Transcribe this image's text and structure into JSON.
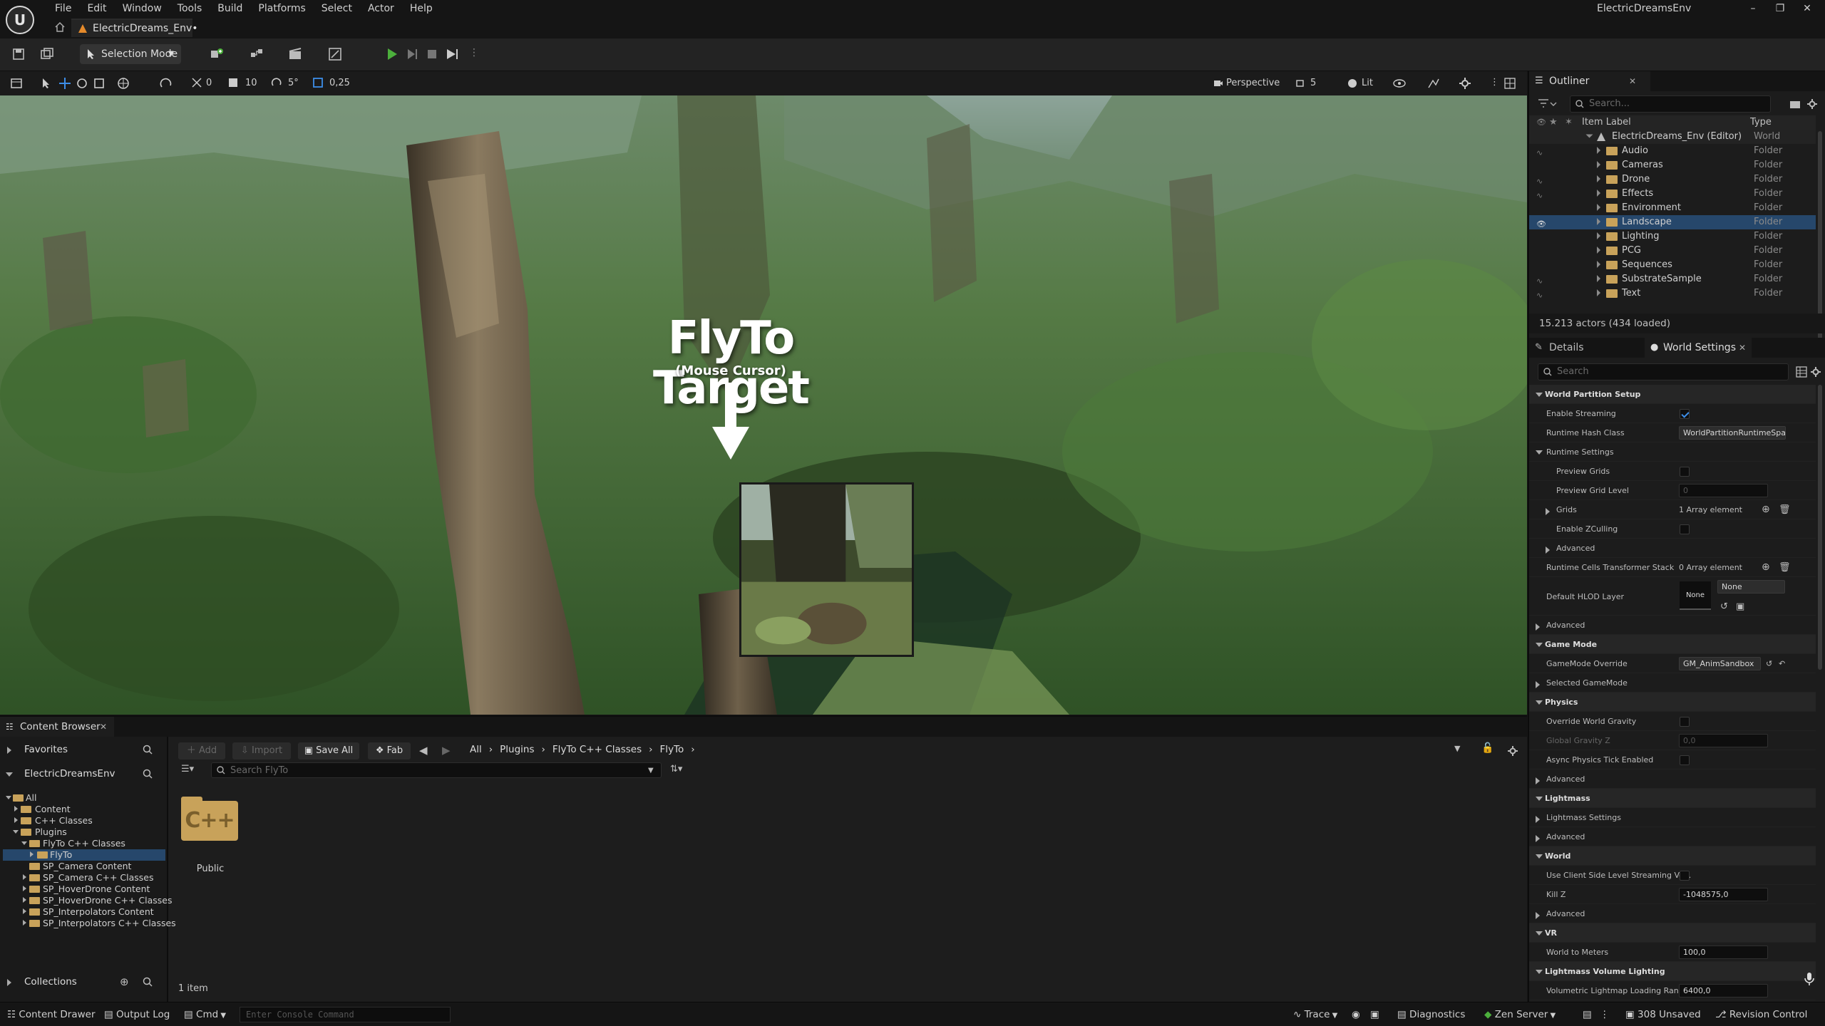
{
  "app": {
    "menus": [
      "File",
      "Edit",
      "Window",
      "Tools",
      "Build",
      "Platforms",
      "Select",
      "Actor",
      "Help"
    ],
    "document_tab": "ElectricDreams_Env•",
    "window_title": "ElectricDreamsEnv"
  },
  "toolbar": {
    "selection_mode": "Selection Mode"
  },
  "viewport": {
    "grid_snap": "10",
    "rotate_snap": "5°",
    "scale_snap": "0,25",
    "angle_value": "0",
    "perspective": "Perspective",
    "camera_speed": "5",
    "view_mode": "Lit",
    "overlay_title": "FlyTo Target",
    "overlay_subtitle": "(Mouse Cursor)"
  },
  "outliner": {
    "tab": "Outliner",
    "search_placeholder": "Search...",
    "col_label": "Item Label",
    "col_type": "Type",
    "root": {
      "label": "ElectricDreams_Env (Editor)",
      "type": "World"
    },
    "items": [
      {
        "label": "Audio",
        "type": "Folder"
      },
      {
        "label": "Cameras",
        "type": "Folder"
      },
      {
        "label": "Drone",
        "type": "Folder"
      },
      {
        "label": "Effects",
        "type": "Folder"
      },
      {
        "label": "Environment",
        "type": "Folder"
      },
      {
        "label": "Landscape",
        "type": "Folder"
      },
      {
        "label": "Lighting",
        "type": "Folder"
      },
      {
        "label": "PCG",
        "type": "Folder"
      },
      {
        "label": "Sequences",
        "type": "Folder"
      },
      {
        "label": "SubstrateSample",
        "type": "Folder"
      },
      {
        "label": "Text",
        "type": "Folder"
      }
    ],
    "selected_index": 5,
    "status": "15.213 actors (434 loaded)"
  },
  "details": {
    "tab_details": "Details",
    "tab_world": "World Settings",
    "search_placeholder": "Search",
    "rows": {
      "wp_setup": "World Partition Setup",
      "enable_streaming": "Enable Streaming",
      "runtime_hash_class": "Runtime Hash Class",
      "runtime_hash_value": "WorldPartitionRuntimeSpatialHash",
      "runtime_settings": "Runtime Settings",
      "preview_grids": "Preview Grids",
      "preview_grid_level": "Preview Grid Level",
      "preview_grid_level_value": "0",
      "grids": "Grids",
      "grids_value": "1 Array element",
      "enable_zculling": "Enable ZCulling",
      "advanced": "Advanced",
      "cells_transformer": "Runtime Cells Transformer Stack",
      "cells_transformer_value": "0 Array element",
      "default_hlod": "Default HLOD Layer",
      "hlod_thumb": "None",
      "hlod_value": "None",
      "game_mode": "Game Mode",
      "gamemode_override": "GameMode Override",
      "gamemode_value": "GM_AnimSandbox",
      "selected_gamemode": "Selected GameMode",
      "physics": "Physics",
      "override_gravity": "Override World Gravity",
      "global_gravity": "Global Gravity Z",
      "global_gravity_value": "0,0",
      "async_physics": "Async Physics Tick Enabled",
      "lightmass": "Lightmass",
      "lightmass_settings": "Lightmass Settings",
      "world": "World",
      "client_streaming": "Use Client Side Level Streaming Vo...",
      "kill_z": "Kill Z",
      "kill_z_value": "-1048575,0",
      "vr": "VR",
      "world_to_meters": "World to Meters",
      "world_to_meters_value": "100,0",
      "lightmass_volume": "Lightmass Volume Lighting",
      "volumetric_range": "Volumetric Lightmap Loading Range",
      "volumetric_range_value": "6400,0"
    }
  },
  "content_browser": {
    "tab": "Content Browser",
    "favorites": "Favorites",
    "project": "ElectricDreamsEnv",
    "tree": [
      {
        "label": "All",
        "depth": 0,
        "open": true
      },
      {
        "label": "Content",
        "depth": 1
      },
      {
        "label": "C++ Classes",
        "depth": 1
      },
      {
        "label": "Plugins",
        "depth": 1,
        "open": true
      },
      {
        "label": "FlyTo C++ Classes",
        "depth": 2,
        "open": true
      },
      {
        "label": "FlyTo",
        "depth": 3,
        "selected": true
      },
      {
        "label": "SP_Camera Content",
        "depth": 2
      },
      {
        "label": "SP_Camera C++ Classes",
        "depth": 2
      },
      {
        "label": "SP_HoverDrone Content",
        "depth": 2
      },
      {
        "label": "SP_HoverDrone C++ Classes",
        "depth": 2
      },
      {
        "label": "SP_Interpolators Content",
        "depth": 2
      },
      {
        "label": "SP_Interpolators C++ Classes",
        "depth": 2
      }
    ],
    "collections": "Collections",
    "add": "Add",
    "import": "Import",
    "save_all": "Save All",
    "fab": "Fab",
    "breadcrumbs": [
      "All",
      "Plugins",
      "FlyTo C++ Classes",
      "FlyTo"
    ],
    "search_placeholder": "Search FlyTo",
    "asset_label": "Public",
    "asset_icon_text": "C++",
    "item_count": "1 item"
  },
  "statusbar": {
    "content_drawer": "Content Drawer",
    "output_log": "Output Log",
    "cmd": "Cmd",
    "console_placeholder": "Enter Console Command",
    "trace": "Trace",
    "diagnostics": "Diagnostics",
    "zen": "Zen Server",
    "unsaved": "308 Unsaved",
    "revision": "Revision Control"
  },
  "colors": {
    "accent": "#26476b",
    "folder": "#c8a25a",
    "play": "#4caf3c"
  }
}
